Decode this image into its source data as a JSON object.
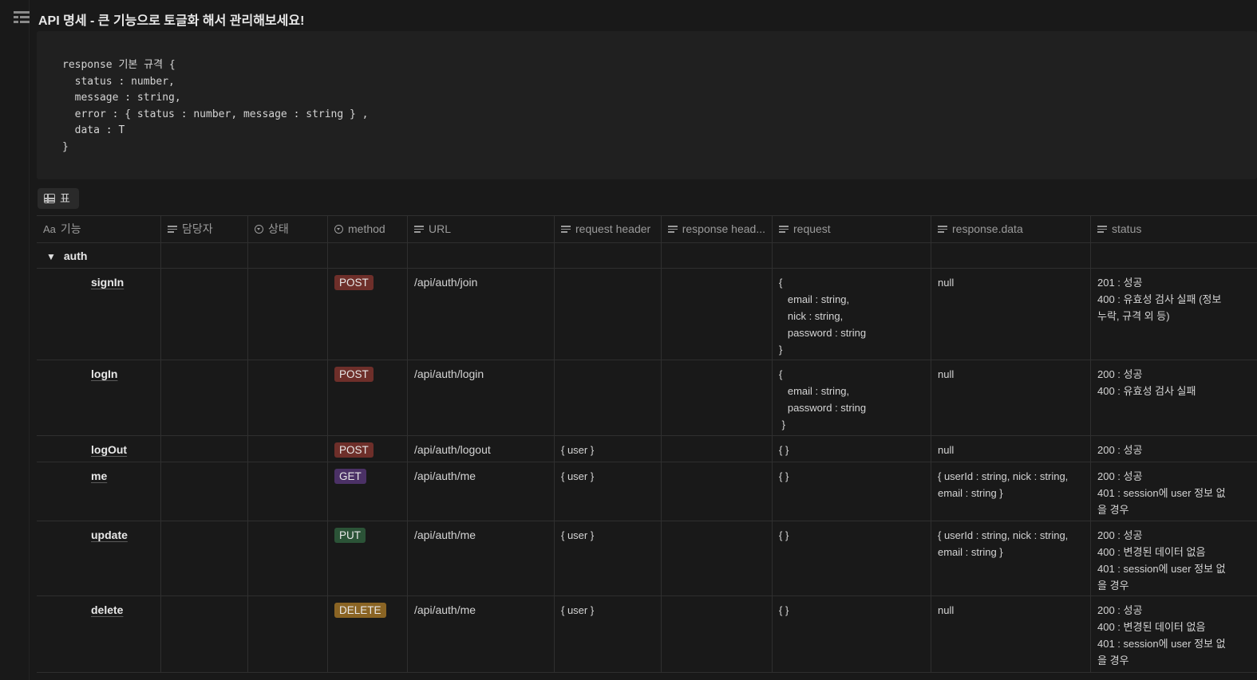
{
  "page": {
    "icon": "page-table-icon",
    "title": "API 명세 - 큰 기능으로 토글화 해서 관리해보세요!"
  },
  "code": {
    "text": "response 기본 규격 {\n  status : number,\n  message : string,\n  error : { status : number, message : string } ,\n  data : T\n}"
  },
  "view": {
    "icon": "table-icon",
    "label": "표"
  },
  "columns": [
    {
      "icon": "aa-text-icon",
      "prefix": "Aa",
      "label": "기능"
    },
    {
      "icon": "lines-icon",
      "label": "담당자"
    },
    {
      "icon": "status-icon",
      "label": "상태"
    },
    {
      "icon": "select-icon",
      "label": "method"
    },
    {
      "icon": "lines-icon",
      "label": "URL"
    },
    {
      "icon": "lines-icon",
      "label": "request header"
    },
    {
      "icon": "lines-icon",
      "label": "response head..."
    },
    {
      "icon": "lines-icon",
      "label": "request"
    },
    {
      "icon": "lines-icon",
      "label": "response.data"
    },
    {
      "icon": "lines-icon",
      "label": "status"
    }
  ],
  "group": {
    "toggle": "▼",
    "name": "auth"
  },
  "rows": [
    {
      "name": "signIn",
      "method": "POST",
      "method_color": "#6e2f2a",
      "url": "/api/auth/join",
      "req_header": "",
      "request": "{\n   email : string,\n   nick : string,\n   password : string\n}",
      "response_data": "null",
      "status": "201 : 성공\n400 : 유효성 검사 실패 (정보\n누락, 규격 외 등)"
    },
    {
      "name": "logIn",
      "method": "POST",
      "method_color": "#6e2f2a",
      "url": "/api/auth/login",
      "req_header": "",
      "request": "{\n   email : string,\n   password : string\n }",
      "response_data": "null",
      "status": "200 : 성공\n400 : 유효성 검사 실패"
    },
    {
      "name": "logOut",
      "method": "POST",
      "method_color": "#6e2f2a",
      "url": "/api/auth/logout",
      "req_header": "{ user }",
      "request": "{ }",
      "response_data": "null",
      "status": "200 : 성공"
    },
    {
      "name": "me",
      "method": "GET",
      "method_color": "#4b3166",
      "url": "/api/auth/me",
      "req_header": "{ user }",
      "request": "{ }",
      "response_data": "{ userId : string, nick : string,\nemail : string }",
      "status": "200 : 성공\n401 : session에 user 정보 없\n을 경우"
    },
    {
      "name": "update",
      "method": "PUT",
      "method_color": "#2b5337",
      "url": "/api/auth/me",
      "req_header": "{ user }",
      "request": "{ }",
      "response_data": "{ userId : string, nick : string,\nemail : string }",
      "status": "200 : 성공\n400 : 변경된 데이터 없음\n401 : session에 user 정보 없\n을 경우"
    },
    {
      "name": "delete",
      "method": "DELETE",
      "method_color": "#8a6424",
      "url": "/api/auth/me",
      "req_header": "{ user }",
      "request": "{ }",
      "response_data": "null",
      "status": "200 : 성공\n400 : 변경된 데이터 없음\n401 : session에 user 정보 없\n을 경우"
    }
  ]
}
